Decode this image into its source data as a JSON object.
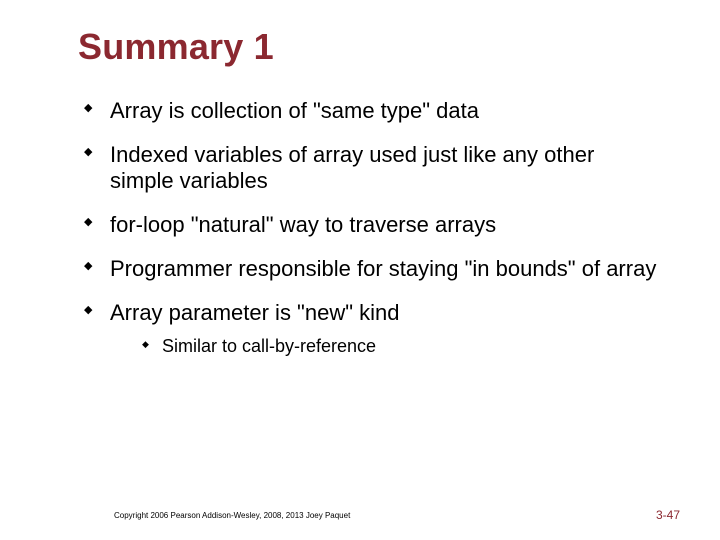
{
  "title": "Summary 1",
  "bullets": {
    "b0": "Array is collection of \"same type\" data",
    "b1": "Indexed variables of array used just like any other simple variables",
    "b2": "for-loop \"natural\" way to traverse arrays",
    "b3": "Programmer responsible for staying \"in bounds\" of array",
    "b4": "Array parameter is \"new\" kind",
    "b4_sub0": "Similar to call-by-reference"
  },
  "footer": {
    "copyright": "Copyright 2006 Pearson Addison-Wesley, 2008, 2013 Joey Paquet",
    "page": "3-47"
  }
}
